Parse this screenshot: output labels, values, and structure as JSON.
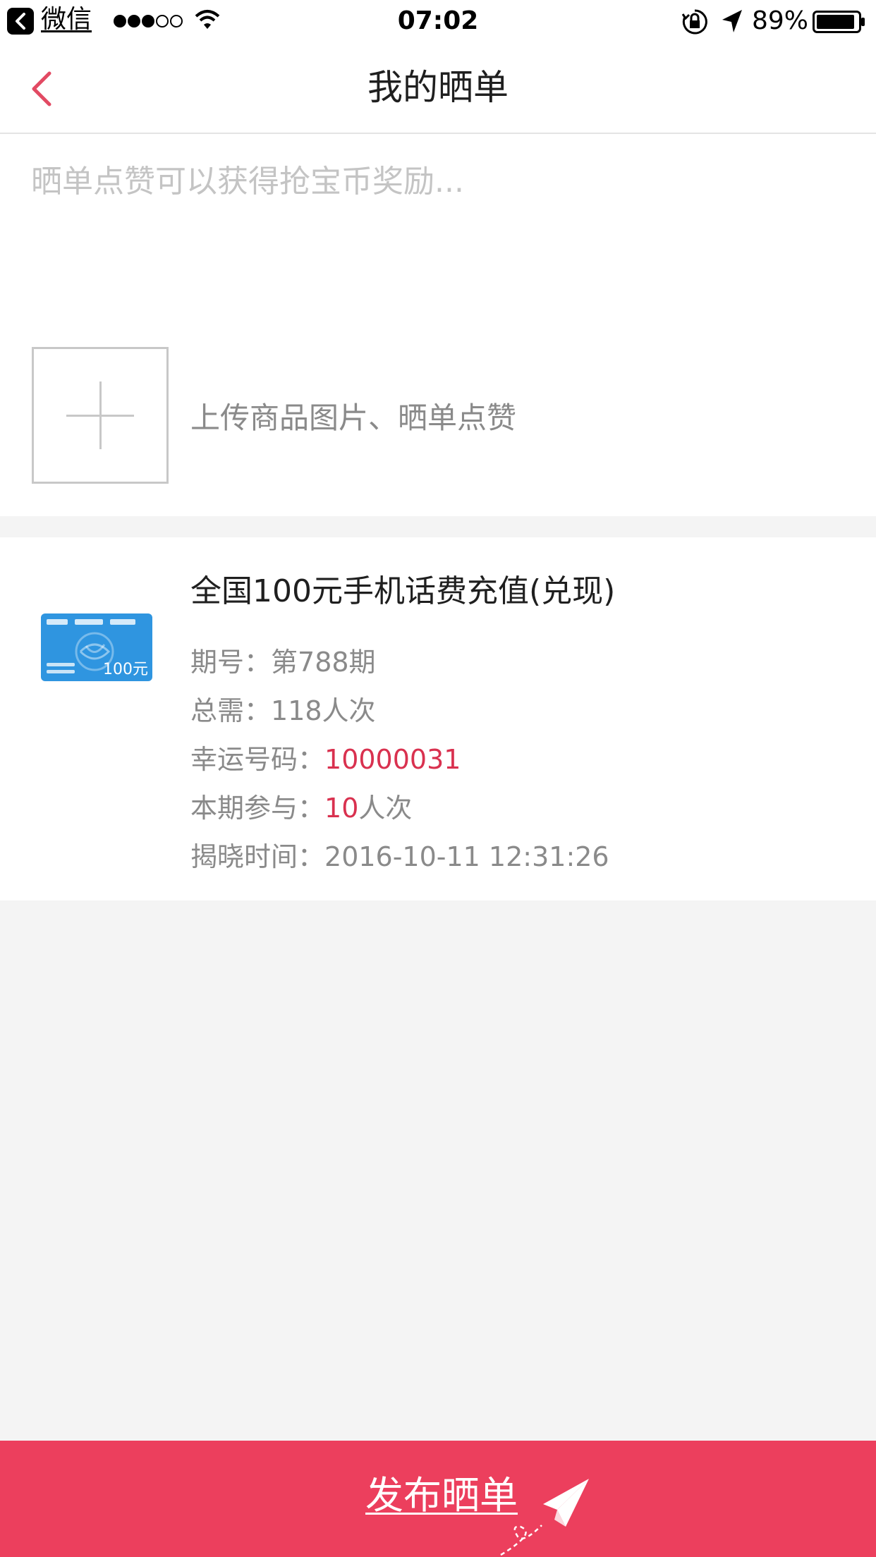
{
  "status_bar": {
    "back_app": "微信",
    "time": "07:02",
    "battery": "89%"
  },
  "nav": {
    "title": "我的晒单"
  },
  "compose": {
    "placeholder": "晒单点赞可以获得抢宝币奖励...",
    "upload_hint": "上传商品图片、晒单点赞"
  },
  "product": {
    "thumbnail_face_value": "100元",
    "title": "全国100元手机话费充值(兑现)",
    "period_label": "期号：",
    "period_value": "第788期",
    "total_label": "总需：",
    "total_value": "118人次",
    "lucky_label": "幸运号码：",
    "lucky_value": "10000031",
    "joined_label": "本期参与：",
    "joined_count": "10",
    "joined_unit": "人次",
    "reveal_label": "揭晓时间：",
    "reveal_value": "2016-10-11 12:31:26"
  },
  "publish": {
    "label": "发布晒单"
  },
  "colors": {
    "accent": "#ec3f5d",
    "highlight": "#d9314f",
    "background": "#f4f4f4"
  },
  "icons": [
    "back-app-icon",
    "signal-icon",
    "wifi-icon",
    "rotation-lock-icon",
    "location-icon",
    "battery-icon",
    "chevron-left-icon",
    "plus-icon",
    "paper-plane-icon"
  ]
}
